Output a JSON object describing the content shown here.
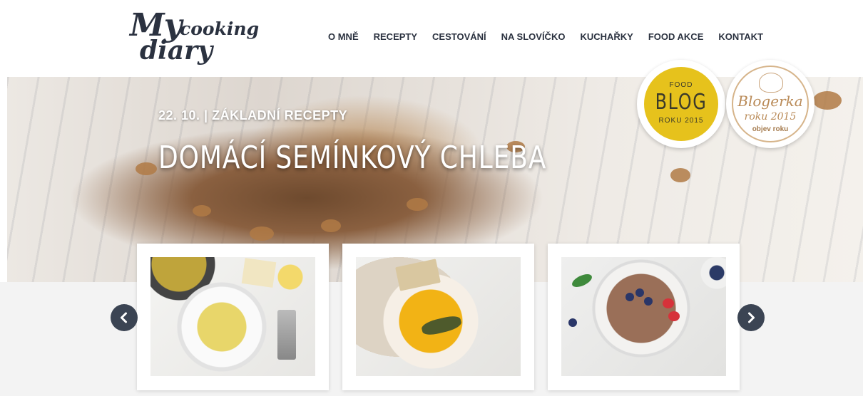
{
  "logo": {
    "line1": "My",
    "line2": "cooking",
    "line3": "diary"
  },
  "nav": [
    {
      "label": "O MNĚ"
    },
    {
      "label": "RECEPTY"
    },
    {
      "label": "CESTOVÁNÍ"
    },
    {
      "label": "NA SLOVÍČKO"
    },
    {
      "label": "KUCHAŘKY"
    },
    {
      "label": "FOOD AKCE"
    },
    {
      "label": "KONTAKT"
    }
  ],
  "hero": {
    "meta": "22. 10. | ZÁKLADNÍ RECEPTY",
    "title": "DOMÁCÍ SEMÍNKOVÝ CHLEBA"
  },
  "badges": {
    "food_blog": {
      "top": "FOOD",
      "main": "BLOG",
      "bottom": "ROKU 2015"
    },
    "blogerka": {
      "main": "Blogerka",
      "year": "roku 2015",
      "sub": "objev roku"
    }
  },
  "carousel": {
    "prev_icon": "chevron-left-icon",
    "next_icon": "chevron-right-icon"
  },
  "colors": {
    "dark": "#3b4453",
    "text": "#2b3240",
    "badge_yellow": "#e6c21c",
    "badge_gold": "#b98a57"
  }
}
